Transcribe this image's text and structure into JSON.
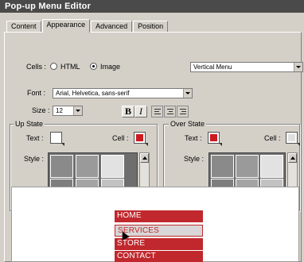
{
  "window": {
    "title": "Pop-up Menu Editor"
  },
  "tabs": [
    {
      "label": "Content"
    },
    {
      "label": "Appearance"
    },
    {
      "label": "Advanced"
    },
    {
      "label": "Position"
    }
  ],
  "cells": {
    "label": "Cells :",
    "html_label": "HTML",
    "image_label": "Image",
    "selected": "Image"
  },
  "orientation": {
    "value": "Vertical Menu"
  },
  "font": {
    "label": "Font :",
    "value": "Arial, Helvetica, sans-serif"
  },
  "size": {
    "label": "Size :",
    "value": "12"
  },
  "format": {
    "bold": "B",
    "italic": "I"
  },
  "up_state": {
    "title": "Up State",
    "text_label": "Text :",
    "cell_label": "Cell :",
    "style_label": "Style :",
    "text_color": "#ffffff",
    "cell_color": "#cc1a22"
  },
  "over_state": {
    "title": "Over State",
    "text_label": "Text :",
    "cell_label": "Cell :",
    "style_label": "Style :",
    "text_color": "#cc1a22",
    "cell_color": "#e0e0e0"
  },
  "preview": {
    "items": [
      {
        "label": "HOME"
      },
      {
        "label": "SERVICES"
      },
      {
        "label": "STORE"
      },
      {
        "label": "CONTACT"
      }
    ],
    "item_color": "#c0282d",
    "hover_color": "#d8d6d6",
    "hover_text_color": "#c0282d"
  }
}
